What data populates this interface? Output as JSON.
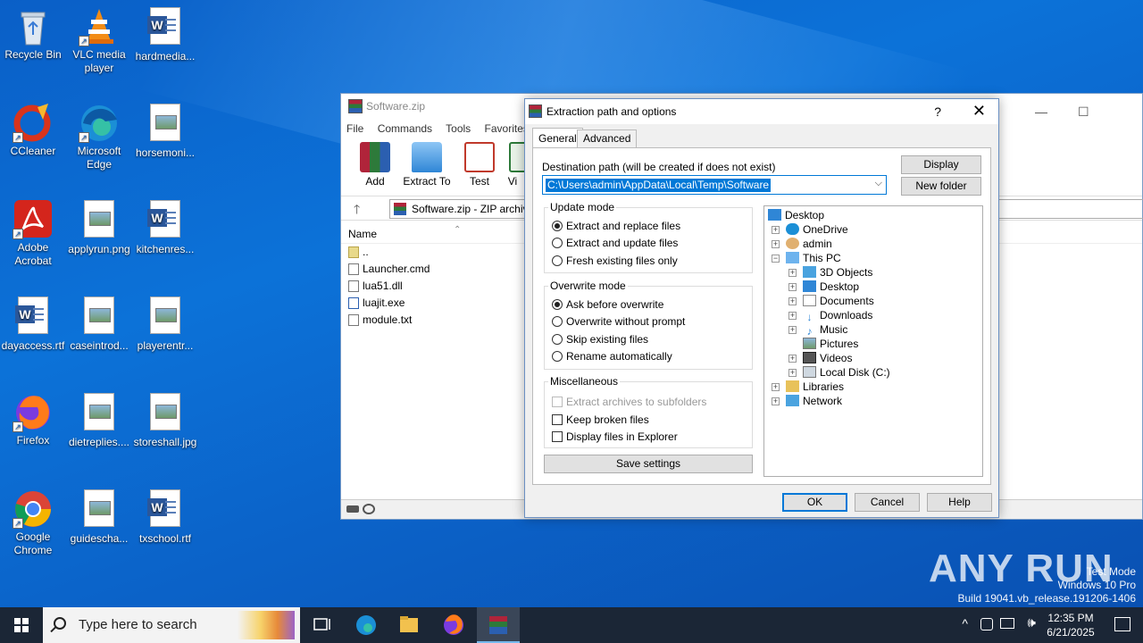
{
  "desktop": {
    "icons": [
      {
        "label": "Recycle Bin"
      },
      {
        "label": "VLC media player"
      },
      {
        "label": "hardmedia..."
      },
      {
        "label": "CCleaner"
      },
      {
        "label": "Microsoft Edge"
      },
      {
        "label": "horsemoni..."
      },
      {
        "label": "Adobe Acrobat"
      },
      {
        "label": "applyrun.png"
      },
      {
        "label": "kitchenres..."
      },
      {
        "label": "dayaccess.rtf"
      },
      {
        "label": "caseintrod..."
      },
      {
        "label": "playerentr..."
      },
      {
        "label": "Firefox"
      },
      {
        "label": "dietreplies...."
      },
      {
        "label": "storeshall.jpg"
      },
      {
        "label": "Google Chrome"
      },
      {
        "label": "guidescha..."
      },
      {
        "label": "txschool.rtf"
      }
    ]
  },
  "winrar": {
    "title": "Software.zip",
    "menu": [
      "File",
      "Commands",
      "Tools",
      "Favorites"
    ],
    "toolbar": [
      {
        "label": "Add",
        "icon": "add-icon"
      },
      {
        "label": "Extract To",
        "icon": "extract-to-icon"
      },
      {
        "label": "Test",
        "icon": "test-icon"
      },
      {
        "label": "Vi",
        "icon": "view-icon"
      }
    ],
    "path": "Software.zip - ZIP archiv",
    "column_name": "Name",
    "files": [
      "..",
      "Launcher.cmd",
      "lua51.dll",
      "luajit.exe",
      "module.txt"
    ]
  },
  "dialog": {
    "title": "Extraction path and options",
    "help_glyph": "?",
    "close_glyph": "✕",
    "tabs": [
      "General",
      "Advanced"
    ],
    "dest_label": "Destination path (will be created if does not exist)",
    "dest_value": "C:\\Users\\admin\\AppData\\Local\\Temp\\Software",
    "display_btn": "Display",
    "new_folder_btn": "New folder",
    "update_mode": {
      "title": "Update mode",
      "options": [
        "Extract and replace files",
        "Extract and update files",
        "Fresh existing files only"
      ],
      "selected": 0
    },
    "overwrite_mode": {
      "title": "Overwrite mode",
      "options": [
        "Ask before overwrite",
        "Overwrite without prompt",
        "Skip existing files",
        "Rename automatically"
      ],
      "selected": 0
    },
    "misc": {
      "title": "Miscellaneous",
      "options": [
        "Extract archives to subfolders",
        "Keep broken files",
        "Display files in Explorer"
      ]
    },
    "save_settings": "Save settings",
    "tree": [
      "Desktop",
      "OneDrive",
      "admin",
      "This PC",
      "3D Objects",
      "Desktop",
      "Documents",
      "Downloads",
      "Music",
      "Pictures",
      "Videos",
      "Local Disk (C:)",
      "Libraries",
      "Network"
    ],
    "ok": "OK",
    "cancel": "Cancel",
    "help": "Help"
  },
  "taskbar": {
    "search_placeholder": "Type here to search",
    "time": "12:35 PM",
    "date": "6/21/2025"
  },
  "watermark": {
    "brand": "ANY RUN",
    "line1": "Test Mode",
    "line2": "Windows 10 Pro",
    "line3": "Build 19041.vb_release.191206-1406"
  }
}
